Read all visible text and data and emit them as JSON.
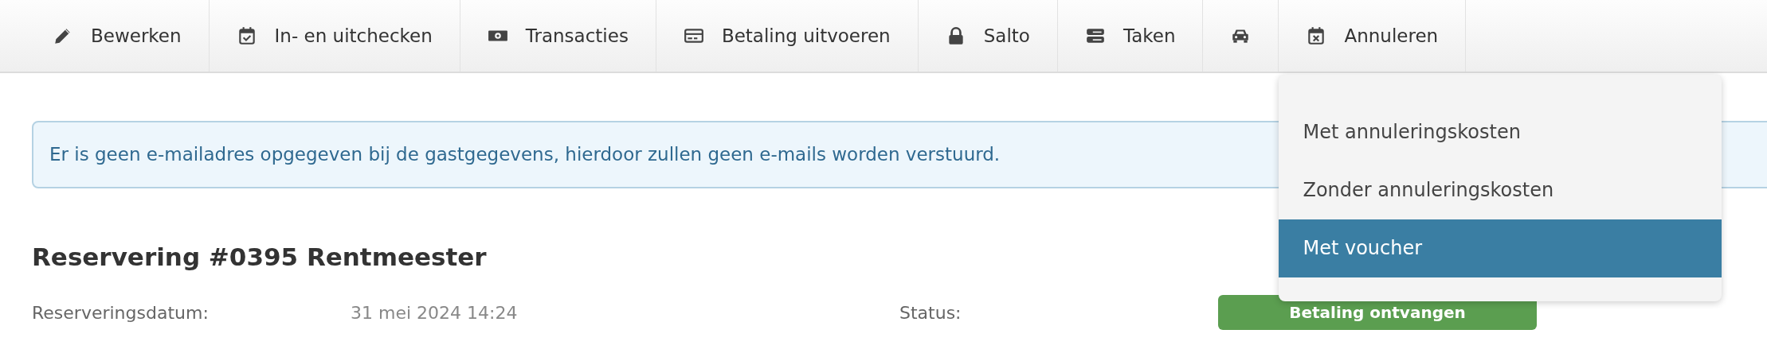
{
  "toolbar": {
    "items": [
      {
        "kind": "labeled",
        "label": "Bewerken"
      },
      {
        "kind": "labeled",
        "label": "In- en uitchecken"
      },
      {
        "kind": "labeled",
        "label": "Transacties"
      },
      {
        "kind": "labeled",
        "label": "Betaling uitvoeren"
      },
      {
        "kind": "labeled",
        "label": "Salto"
      },
      {
        "kind": "labeled",
        "label": "Taken"
      },
      {
        "kind": "icon"
      },
      {
        "kind": "labeled",
        "label": "Annuleren",
        "menu": [
          {
            "label": "Met annuleringskosten",
            "selected": false
          },
          {
            "label": "Zonder annuleringskosten",
            "selected": false
          },
          {
            "label": "Met voucher",
            "selected": true
          }
        ]
      }
    ]
  },
  "alert": {
    "text": "Er is geen e-mailadres opgegeven bij de gastgegevens, hierdoor zullen geen e-mails worden verstuurd."
  },
  "reservation": {
    "title": "Reservering #0395 Rentmeester",
    "left": [
      {
        "label": "Reserveringsdatum:",
        "value": "31 mei 2024 14:24"
      }
    ],
    "right": [
      {
        "label": "Status:",
        "value": "Betaling ontvangen",
        "kind": "badge",
        "color": "#5b9e50"
      }
    ]
  }
}
